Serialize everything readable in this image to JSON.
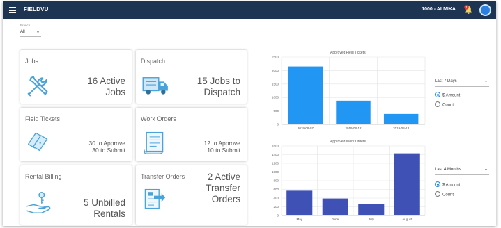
{
  "header": {
    "app_title": "FIELDVU",
    "user": "1000 - ALMIKA",
    "notification_count": "1",
    "bar_color": "#1e3453"
  },
  "filter": {
    "branch_label": "Branch",
    "branch_value": "All"
  },
  "cards": {
    "jobs": {
      "title": "Jobs",
      "value_line1": "16 Active",
      "value_line2": "Jobs"
    },
    "dispatch": {
      "title": "Dispatch",
      "value_line1": "15 Jobs to",
      "value_line2": "Dispatch"
    },
    "field_tickets": {
      "title": "Field Tickets",
      "value_line1": "30 to Approve",
      "value_line2": "30 to Submit"
    },
    "work_orders": {
      "title": "Work Orders",
      "value_line1": "12 to Approve",
      "value_line2": "10 to Submit"
    },
    "rental_billing": {
      "title": "Rental Billing",
      "value_line1": "5 Unbilled",
      "value_line2": "Rentals"
    },
    "transfer_orders": {
      "title": "Transfer Orders",
      "value_line1": "2 Active",
      "value_line2": "Transfer",
      "value_line3": "Orders"
    }
  },
  "chart_data": [
    {
      "type": "bar",
      "title": "Approved Field Tickets",
      "categories": [
        "2019-08-07",
        "2019-08-12",
        "2019-08-13"
      ],
      "values": [
        2150,
        880,
        390
      ],
      "ylim": [
        0,
        2500
      ],
      "yticks": [
        "0",
        "500",
        "1000",
        "1500",
        "2000",
        "2500"
      ],
      "color": "#2196f3",
      "grid": true
    },
    {
      "type": "bar",
      "title": "Approved Work Orders",
      "categories": [
        "May",
        "June",
        "July",
        "August"
      ],
      "values": [
        570,
        390,
        270,
        1430
      ],
      "ylim": [
        0,
        1600
      ],
      "yticks": [
        "0",
        "200",
        "400",
        "600",
        "800",
        "1000",
        "1200",
        "1400",
        "1600"
      ],
      "color": "#3f51b5",
      "grid": true
    }
  ],
  "controls": {
    "tickets_range": "Last 7 Days",
    "orders_range": "Last 4 Months",
    "amount_label": "$ Amount",
    "count_label": "Count",
    "selected": "$ Amount"
  }
}
